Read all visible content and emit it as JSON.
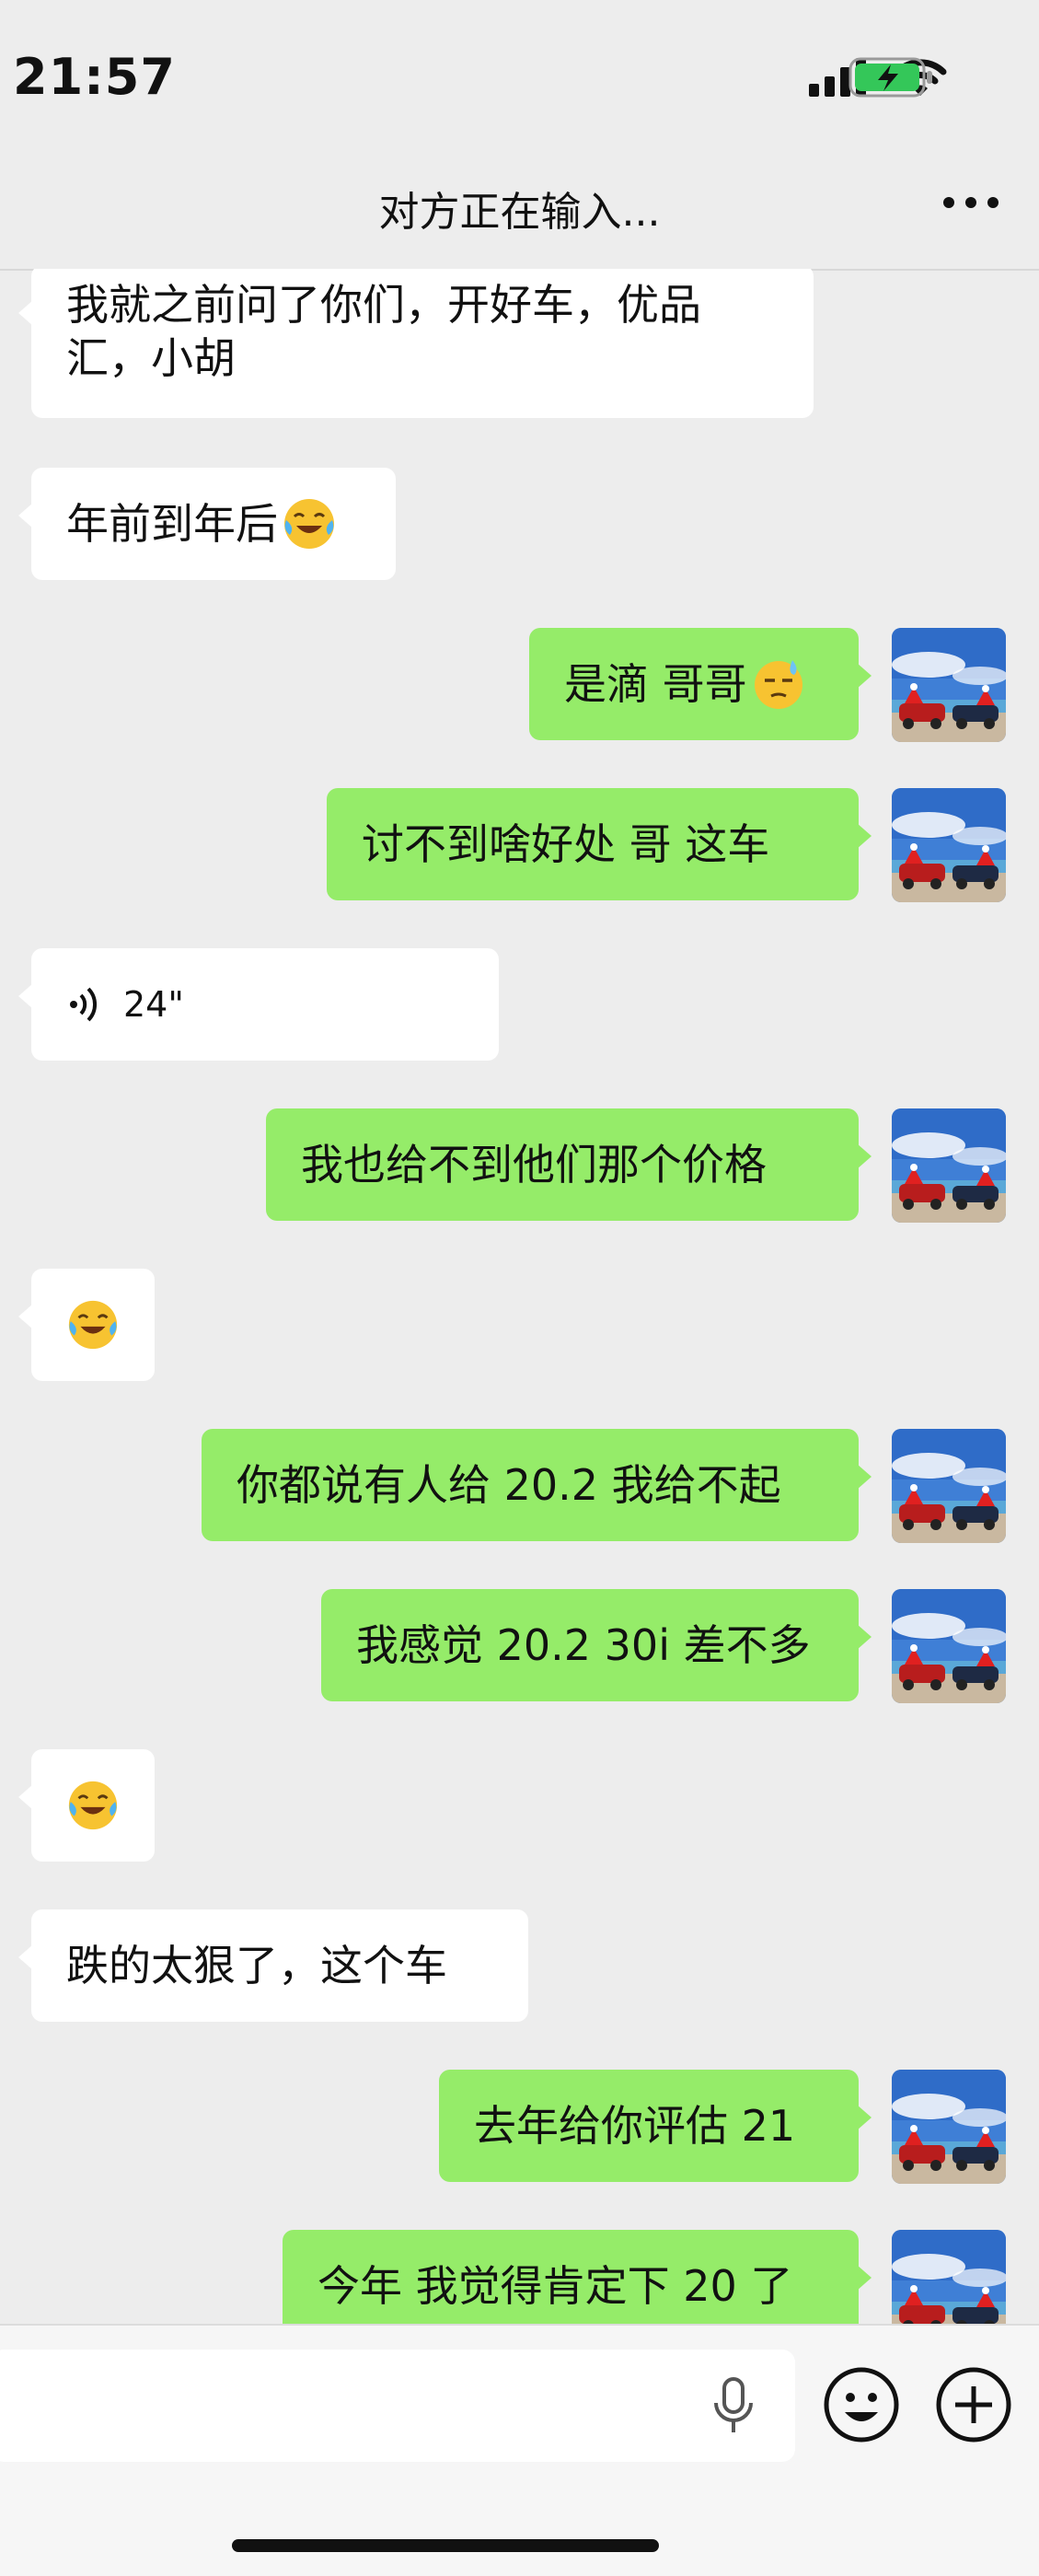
{
  "status_bar": {
    "time": "21:57"
  },
  "nav": {
    "title": "对方正在输入..."
  },
  "messages": [
    {
      "side": "left",
      "text": "我就之前问了你们，开好车，优品汇，小胡",
      "line1": "我就之前问了你们，开好车，优品",
      "line2": "汇，小胡"
    },
    {
      "side": "left",
      "text": "年前到年后",
      "emoji": "crying-laugh-emoji"
    },
    {
      "side": "right",
      "text": "是滴 哥哥",
      "emoji": "sweat-emoji"
    },
    {
      "side": "right",
      "text": "讨不到啥好处 哥 这车"
    },
    {
      "side": "left",
      "type": "voice",
      "duration": "24\""
    },
    {
      "side": "right",
      "text": "我也给不到他们那个价格"
    },
    {
      "side": "left",
      "type": "emoji-only",
      "emoji": "crying-laugh-emoji"
    },
    {
      "side": "right",
      "text": "你都说有人给 20.2 我给不起"
    },
    {
      "side": "right",
      "text": "我感觉 20.2 30i 差不多"
    },
    {
      "side": "left",
      "type": "emoji-only",
      "emoji": "crying-laugh-emoji"
    },
    {
      "side": "left",
      "text": "跌的太狠了，这个车"
    },
    {
      "side": "right",
      "text": "去年给你评估 21"
    },
    {
      "side": "right",
      "text": "今年 我觉得肯定下 20 了"
    }
  ],
  "colors": {
    "sent_bubble": "#95ec69",
    "received_bubble": "#ffffff",
    "background": "#ededed"
  },
  "icons": [
    "signal-icon",
    "wifi-icon",
    "battery-charging-icon",
    "more-icon",
    "voice-icon",
    "mic-icon",
    "emoji-button-icon",
    "plus-icon"
  ]
}
